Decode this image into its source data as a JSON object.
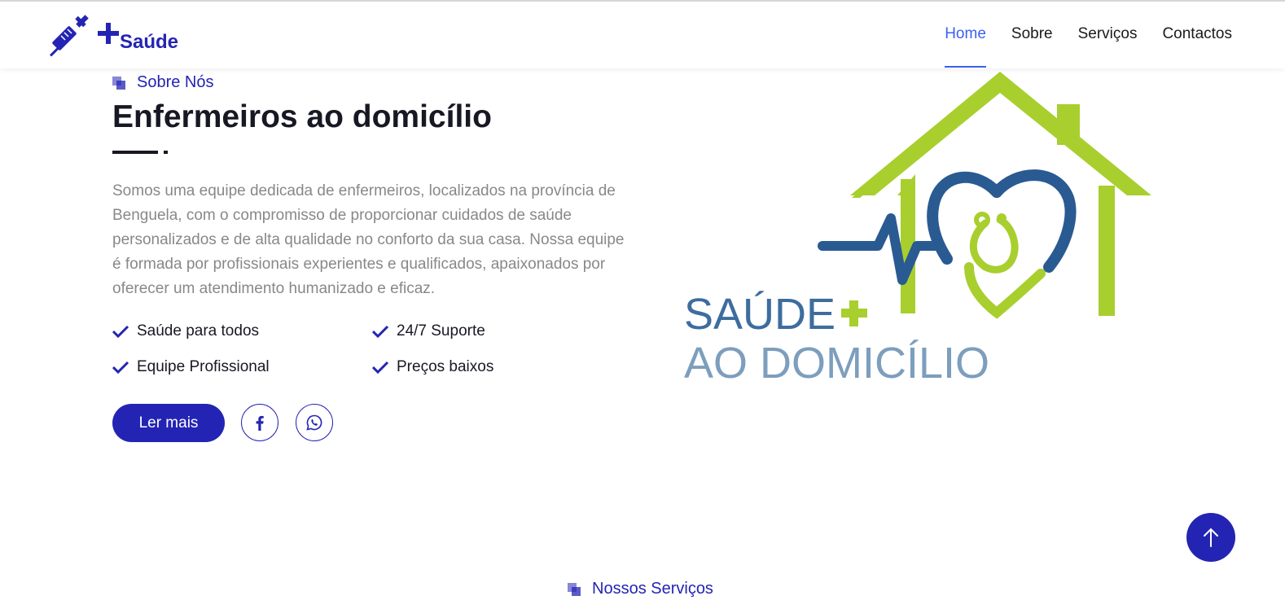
{
  "header": {
    "brand_text": "Saúde",
    "nav": [
      {
        "label": "Home",
        "active": true
      },
      {
        "label": "Sobre",
        "active": false
      },
      {
        "label": "Serviços",
        "active": false
      },
      {
        "label": "Contactos",
        "active": false
      }
    ]
  },
  "about": {
    "tag": "Sobre Nós",
    "title": "Enfermeiros ao domicílio",
    "description": "Somos uma equipe dedicada de enfermeiros, localizados na província de Benguela, com o compromisso de proporcionar cuidados de saúde personalizados e de alta qualidade no conforto da sua casa. Nossa equipe é formada por profissionais experientes e qualificados, apaixonados por oferecer um atendimento humanizado e eficaz.",
    "features": [
      "Saúde para todos",
      "24/7 Suporte",
      "Equipe Profissional",
      "Preços baixos"
    ],
    "read_more": "Ler mais",
    "social": [
      "facebook-icon",
      "whatsapp-icon"
    ]
  },
  "logo": {
    "line1": "SAÚDE",
    "line2": "AO DOMICÍLIO"
  },
  "services": {
    "tag": "Nossos Serviços"
  },
  "colors": {
    "primary": "#2424b4",
    "nav_active": "#3b5ff0",
    "logo_green": "#a8cf2e",
    "logo_blue": "#2a5a92",
    "logo_light_blue": "#7d9ebd"
  }
}
